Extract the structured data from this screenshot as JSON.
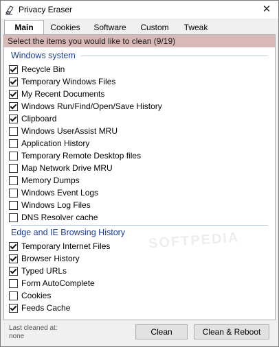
{
  "window": {
    "title": "Privacy Eraser"
  },
  "tabs": [
    {
      "label": "Main",
      "active": true
    },
    {
      "label": "Cookies",
      "active": false
    },
    {
      "label": "Software",
      "active": false
    },
    {
      "label": "Custom",
      "active": false
    },
    {
      "label": "Tweak",
      "active": false
    }
  ],
  "instruction": "Select the items you would like to clean (9/19)",
  "groups": [
    {
      "title": "Windows system",
      "items": [
        {
          "label": "Recycle Bin",
          "checked": true
        },
        {
          "label": "Temporary Windows Files",
          "checked": true
        },
        {
          "label": "My Recent Documents",
          "checked": true
        },
        {
          "label": "Windows Run/Find/Open/Save History",
          "checked": true
        },
        {
          "label": "Clipboard",
          "checked": true
        },
        {
          "label": "Windows UserAssist MRU",
          "checked": false
        },
        {
          "label": "Application History",
          "checked": false
        },
        {
          "label": "Temporary Remote Desktop files",
          "checked": false
        },
        {
          "label": "Map Network Drive MRU",
          "checked": false
        },
        {
          "label": "Memory Dumps",
          "checked": false
        },
        {
          "label": "Windows Event Logs",
          "checked": false
        },
        {
          "label": "Windows Log Files",
          "checked": false
        },
        {
          "label": "DNS Resolver cache",
          "checked": false
        }
      ]
    },
    {
      "title": "Edge and IE Browsing History",
      "items": [
        {
          "label": "Temporary Internet Files",
          "checked": true
        },
        {
          "label": "Browser History",
          "checked": true
        },
        {
          "label": "Typed URLs",
          "checked": true
        },
        {
          "label": "Form AutoComplete",
          "checked": false
        },
        {
          "label": "Cookies",
          "checked": false
        },
        {
          "label": "Feeds Cache",
          "checked": true
        }
      ]
    }
  ],
  "watermark": "SOFTPEDIA",
  "footer": {
    "last_cleaned_label": "Last cleaned at:",
    "last_cleaned_value": "none",
    "clean_button": "Clean",
    "clean_reboot_button": "Clean & Reboot"
  }
}
